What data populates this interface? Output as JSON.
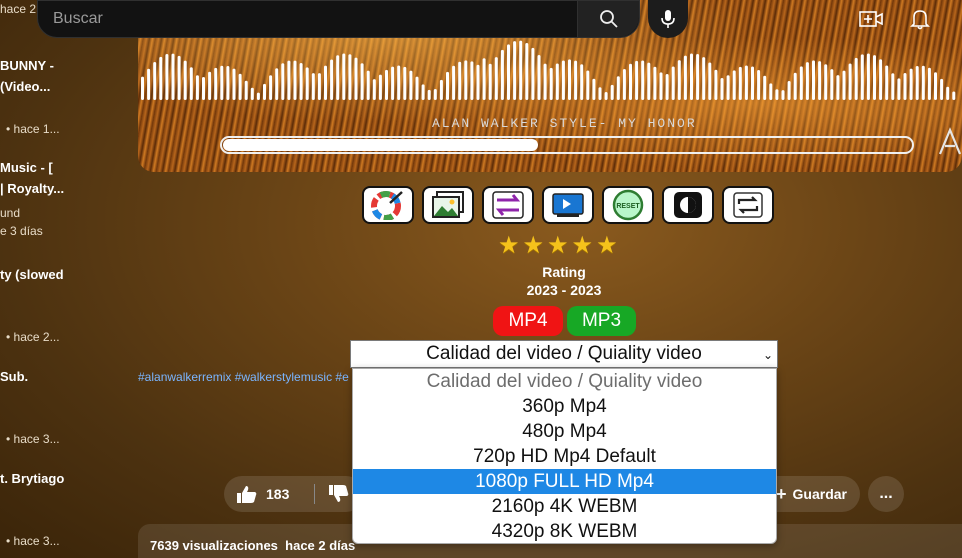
{
  "search": {
    "placeholder": "Buscar"
  },
  "sidebar": {
    "items": [
      {
        "title_lines": [],
        "meta": [
          "hace 2..."
        ]
      },
      {
        "title_lines": [
          "BUNNY -",
          "(Video..."
        ],
        "meta": [
          "• hace 1..."
        ]
      },
      {
        "title_lines": [
          "Music - [",
          "| Royalty..."
        ],
        "meta": [
          "und",
          "e 3 días"
        ]
      },
      {
        "title_lines": [
          "ty (slowed"
        ],
        "meta": [
          "• hace 2..."
        ]
      },
      {
        "title_lines": [
          "Sub."
        ],
        "meta": [
          "• hace 3..."
        ]
      },
      {
        "title_lines": [
          "t. Brytiago"
        ],
        "meta": [
          "• hace 3..."
        ]
      }
    ]
  },
  "banner": {
    "title": "ALAN WALKER STYLE- MY HONOR",
    "progress": 0.46,
    "accent": "#ffffff"
  },
  "tools": [
    {
      "name": "color-picker-icon"
    },
    {
      "name": "image-icon"
    },
    {
      "name": "swap-icon"
    },
    {
      "name": "display-icon"
    },
    {
      "name": "reset-icon",
      "label": "RESET"
    },
    {
      "name": "contrast-icon"
    },
    {
      "name": "repeat-icon"
    }
  ],
  "rating": {
    "stars": 5,
    "label": "Rating",
    "years": "2023 - 2023"
  },
  "formats": {
    "mp4": "MP4",
    "mp3": "MP3",
    "mp4_color": "#f01414",
    "mp3_color": "#17a825"
  },
  "quality": {
    "selected": "Calidad del video / Quiality video",
    "options": [
      "Calidad del video / Quiality video",
      "360p Mp4",
      "480p Mp4",
      "720p HD Mp4 Default",
      "1080p FULL HD Mp4",
      "2160p 4K WEBM",
      "4320p 8K WEBM"
    ],
    "highlighted": "1080p FULL HD Mp4"
  },
  "hashtags": "#alanwalkerremix #walkerstylemusic #e",
  "actions": {
    "likes": "183",
    "save": "Guardar",
    "more": "..."
  },
  "description": {
    "views": "7639 visualizaciones",
    "date": "hace 2 días"
  }
}
